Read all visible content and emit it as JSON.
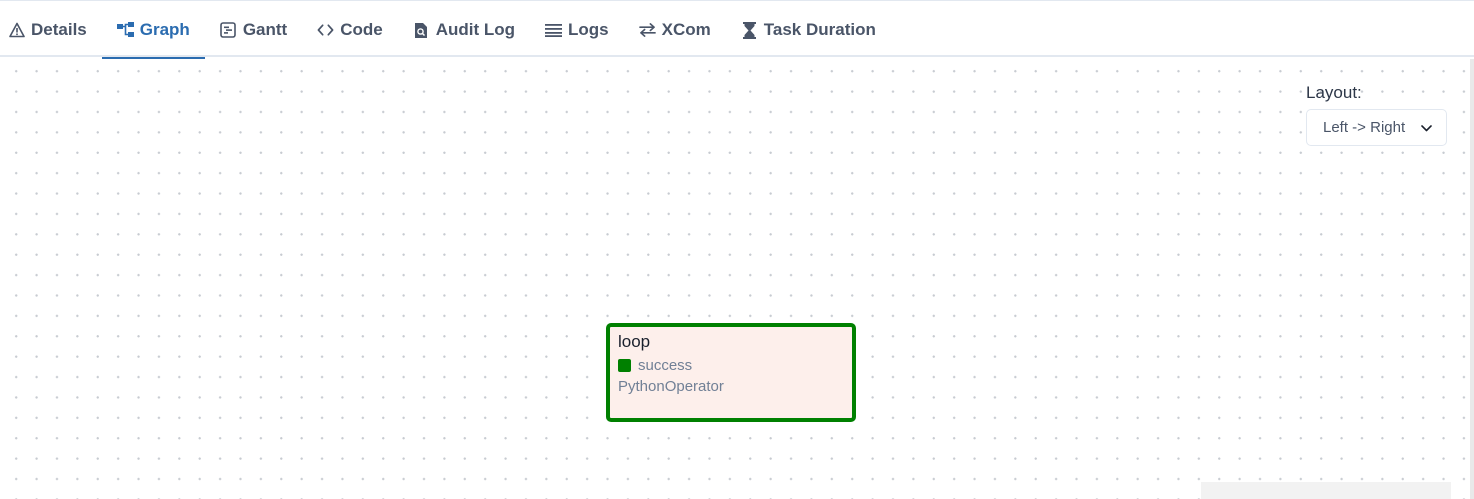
{
  "tabs": [
    {
      "label": "Details",
      "icon": "warning-triangle-icon"
    },
    {
      "label": "Graph",
      "icon": "graph-icon"
    },
    {
      "label": "Gantt",
      "icon": "gantt-icon"
    },
    {
      "label": "Code",
      "icon": "code-icon"
    },
    {
      "label": "Audit Log",
      "icon": "file-search-icon"
    },
    {
      "label": "Logs",
      "icon": "list-icon"
    },
    {
      "label": "XCom",
      "icon": "swap-arrows-icon"
    },
    {
      "label": "Task Duration",
      "icon": "hourglass-icon"
    }
  ],
  "active_tab": "Graph",
  "layout": {
    "label": "Layout:",
    "selected": "Left -> Right"
  },
  "node": {
    "task_id": "loop",
    "state": "success",
    "operator": "PythonOperator"
  },
  "colors": {
    "active_tab": "#2b6cb0",
    "tab_text": "#4a5568",
    "node_border": "#008000",
    "node_background": "#fdefeb",
    "success": "#008000"
  }
}
